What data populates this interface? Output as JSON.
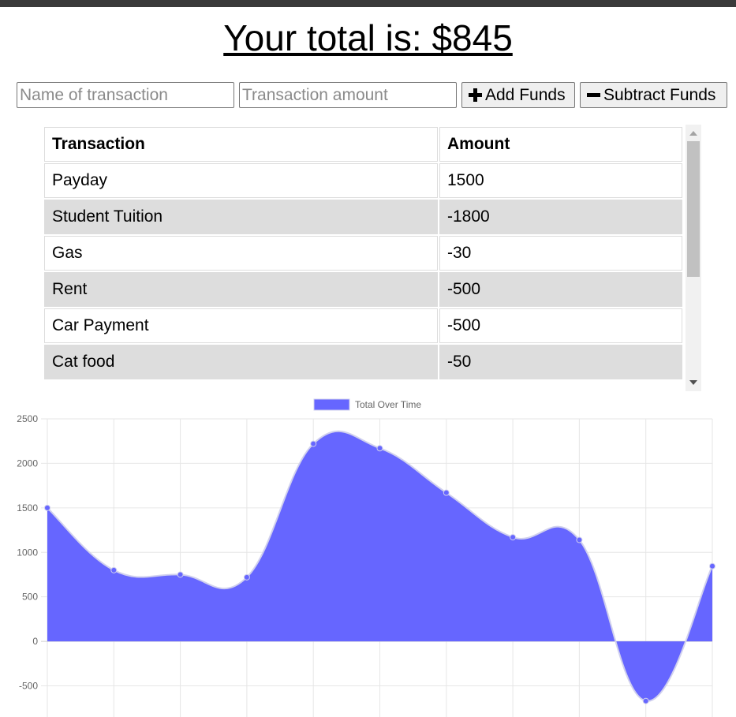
{
  "header": {
    "total_text": "Your total is: $845"
  },
  "form": {
    "name_placeholder": "Name of transaction",
    "amount_placeholder": "Transaction amount",
    "add_label": "Add Funds",
    "subtract_label": "Subtract Funds"
  },
  "table": {
    "headers": [
      "Transaction",
      "Amount"
    ],
    "rows": [
      {
        "name": "Payday",
        "amount": "1500"
      },
      {
        "name": "Student Tuition",
        "amount": "-1800"
      },
      {
        "name": "Gas",
        "amount": "-30"
      },
      {
        "name": "Rent",
        "amount": "-500"
      },
      {
        "name": "Car Payment",
        "amount": "-500"
      },
      {
        "name": "Cat food",
        "amount": "-50"
      }
    ]
  },
  "chart_data": {
    "type": "area",
    "series": [
      {
        "name": "Total Over Time",
        "values": [
          1500,
          800,
          750,
          720,
          2220,
          2170,
          1670,
          1170,
          1140,
          -670,
          845
        ]
      }
    ],
    "ylim": [
      -850,
      2500
    ],
    "yticks": [
      2500,
      2000,
      1500,
      1000,
      500,
      0,
      -500
    ],
    "grid": true,
    "legend": "top-center",
    "fill_color": "#6666ff",
    "line_color": "#d0d0ee"
  },
  "colors": {
    "row_alt": "#dddddd",
    "accent": "#6666ff"
  }
}
